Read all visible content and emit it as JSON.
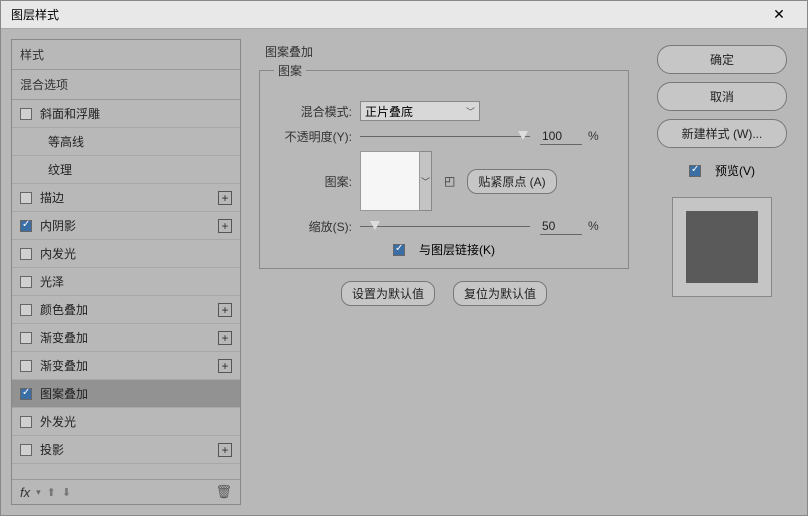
{
  "titlebar": {
    "title": "图层样式"
  },
  "left": {
    "header_styles": "样式",
    "header_blend": "混合选项",
    "items": [
      {
        "label": "斜面和浮雕",
        "checked": false,
        "plus": false,
        "indent": false
      },
      {
        "label": "等高线",
        "checked": false,
        "plus": false,
        "indent": true,
        "no_chk": true
      },
      {
        "label": "纹理",
        "checked": false,
        "plus": false,
        "indent": true,
        "no_chk": true
      },
      {
        "label": "描边",
        "checked": false,
        "plus": true,
        "indent": false
      },
      {
        "label": "内阴影",
        "checked": true,
        "plus": true,
        "indent": false
      },
      {
        "label": "内发光",
        "checked": false,
        "plus": false,
        "indent": false
      },
      {
        "label": "光泽",
        "checked": false,
        "plus": false,
        "indent": false
      },
      {
        "label": "颜色叠加",
        "checked": false,
        "plus": true,
        "indent": false
      },
      {
        "label": "渐变叠加",
        "checked": false,
        "plus": true,
        "indent": false
      },
      {
        "label": "渐变叠加",
        "checked": false,
        "plus": true,
        "indent": false
      },
      {
        "label": "图案叠加",
        "checked": true,
        "plus": false,
        "indent": false,
        "selected": true
      },
      {
        "label": "外发光",
        "checked": false,
        "plus": false,
        "indent": false
      },
      {
        "label": "投影",
        "checked": false,
        "plus": true,
        "indent": false
      }
    ],
    "fx": "fx"
  },
  "center": {
    "group_title": "图案叠加",
    "legend": "图案",
    "blend_mode_label": "混合模式:",
    "blend_mode_value": "正片叠底",
    "opacity_label": "不透明度(Y):",
    "opacity_value": "100",
    "pattern_label": "图案:",
    "snap_button": "贴紧原点 (A)",
    "scale_label": "缩放(S):",
    "scale_value": "50",
    "link_label": "与图层链接(K)",
    "set_default": "设置为默认值",
    "reset_default": "复位为默认值",
    "percent": "%"
  },
  "right": {
    "ok": "确定",
    "cancel": "取消",
    "new_style": "新建样式 (W)...",
    "preview": "预览(V)"
  }
}
